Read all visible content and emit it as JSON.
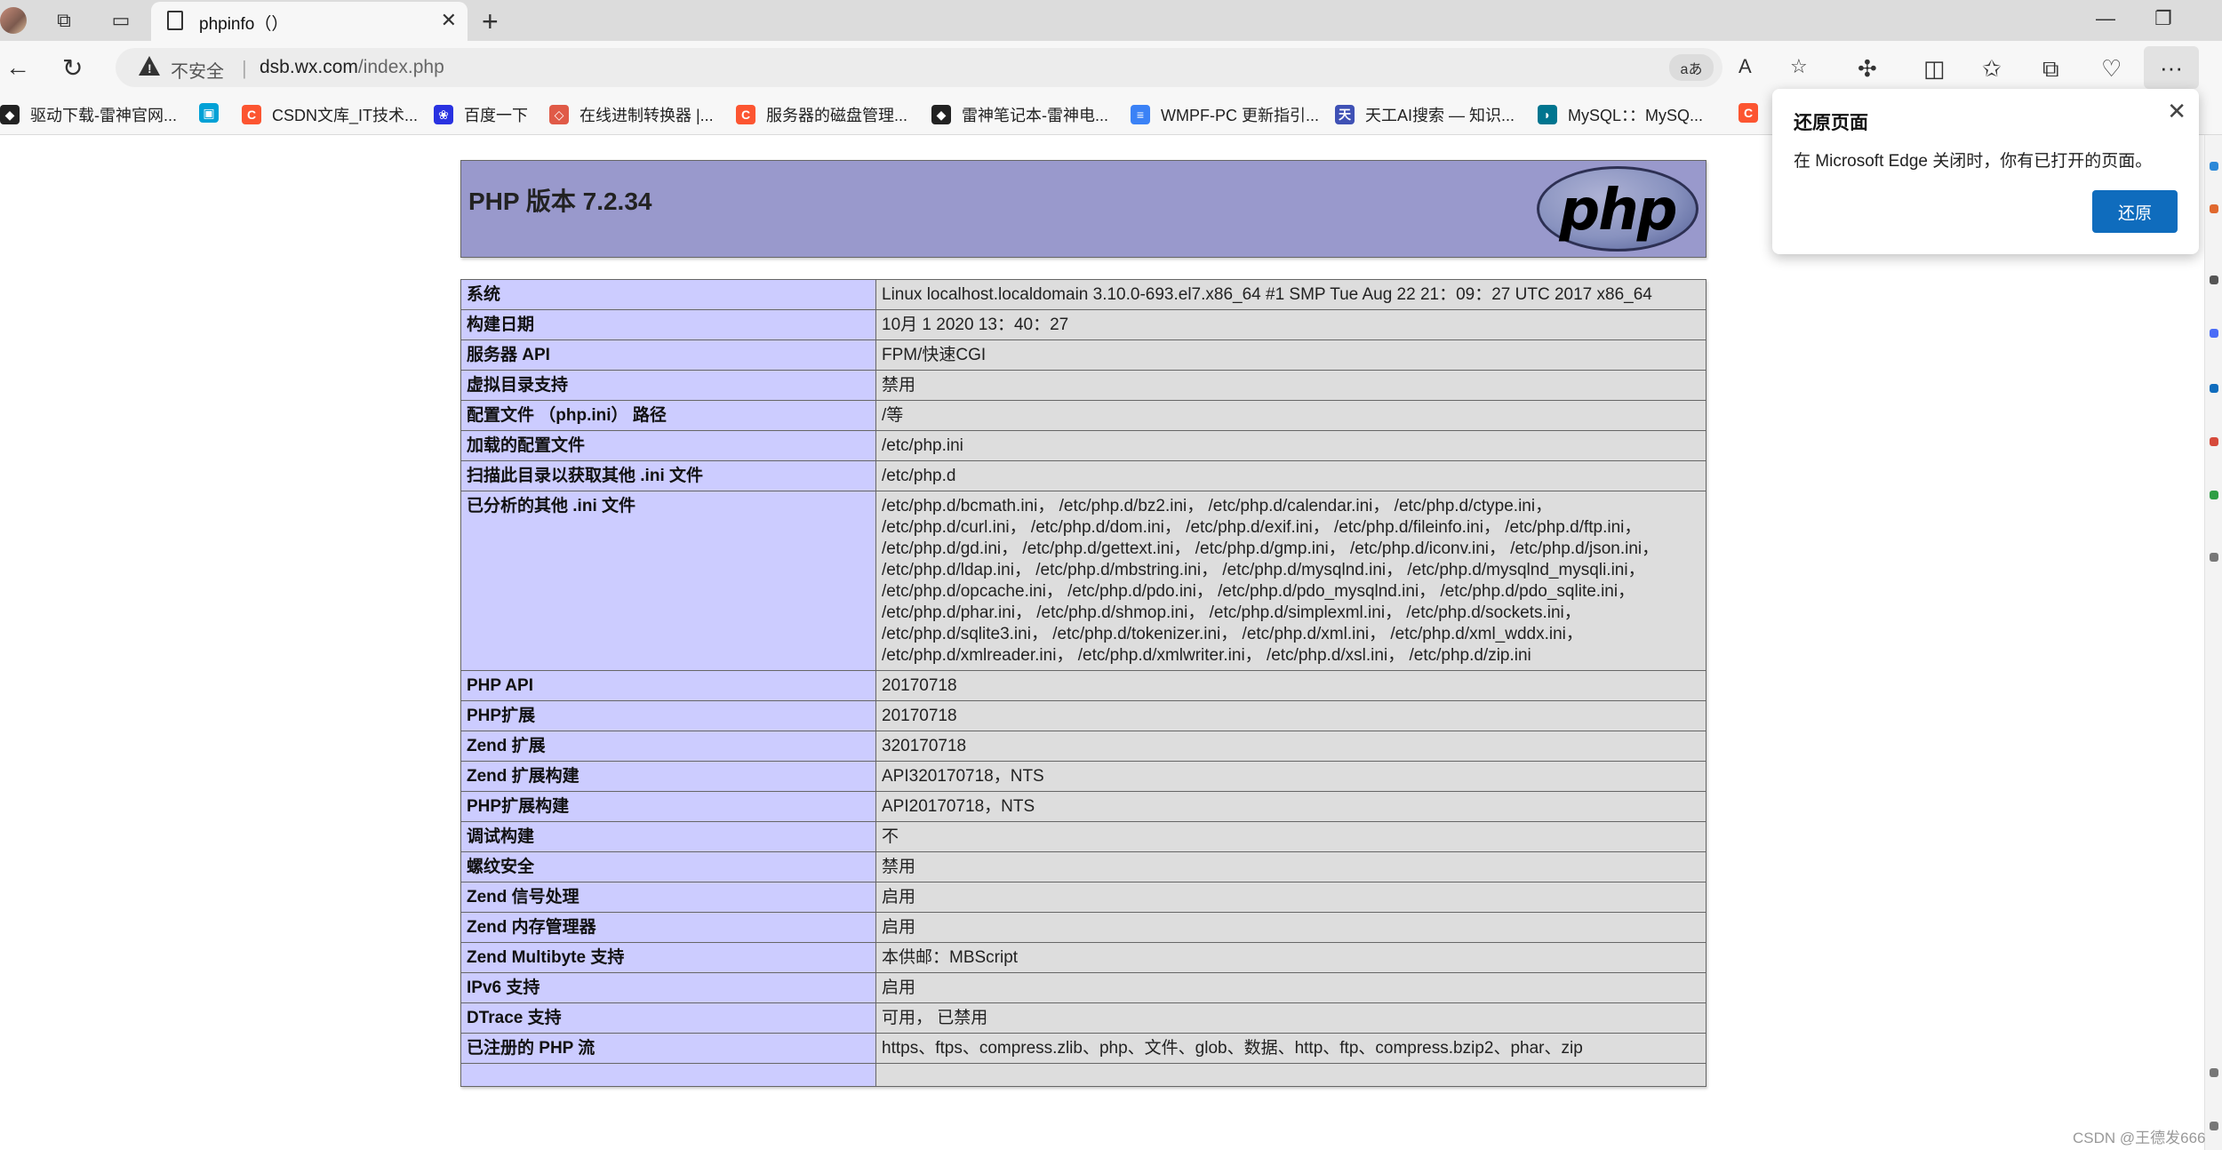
{
  "browser": {
    "tab_title": "phpinfo（）",
    "address_insecure": "不安全",
    "url_host": "dsb.wx.com",
    "url_path": "/index.php",
    "translate_label": "aあ",
    "more_label": "···"
  },
  "bookmarks": [
    {
      "label": "驱动下载-雷神官网...",
      "icon": "leishen-icon",
      "color": "#222222"
    },
    {
      "label": "",
      "icon": "bilibili-icon",
      "color": "#00a1d6"
    },
    {
      "label": "CSDN文库_IT技术...",
      "icon": "csdn-icon",
      "color": "#fc5531"
    },
    {
      "label": "百度一下",
      "icon": "baidu-icon",
      "color": "#2932e1"
    },
    {
      "label": "在线进制转换器 |...",
      "icon": "converter-icon",
      "color": "#e05a47"
    },
    {
      "label": "服务器的磁盘管理...",
      "icon": "csdn-icon",
      "color": "#fc5531"
    },
    {
      "label": "雷神笔记本-雷神电...",
      "icon": "leishen-icon",
      "color": "#222222"
    },
    {
      "label": "WMPF-PC 更新指引...",
      "icon": "doc-icon",
      "color": "#3b82f6"
    },
    {
      "label": "天工AI搜索 — 知识...",
      "icon": "tiangong-icon",
      "color": "#3f51b5"
    },
    {
      "label": "MySQL：：MySQ...",
      "icon": "mysql-icon",
      "color": "#00758f"
    },
    {
      "label": "",
      "icon": "csdn-icon",
      "color": "#fc5531"
    }
  ],
  "restore_popup": {
    "title": "还原页面",
    "message": "在 Microsoft Edge 关闭时，你有已打开的页面。",
    "button": "还原"
  },
  "php": {
    "header_title": "PHP 版本 7.2.34",
    "logo_text": "php",
    "rows": [
      {
        "k": "系统",
        "v": "Linux localhost.localdomain 3.10.0-693.el7.x86_64 #1 SMP Tue Aug 22 21：09：27 UTC 2017 x86_64"
      },
      {
        "k": "构建日期",
        "v": "10月 1 2020 13：40：27"
      },
      {
        "k": "服务器 API",
        "v": "FPM/快速CGI"
      },
      {
        "k": "虚拟目录支持",
        "v": "禁用"
      },
      {
        "k": "配置文件 （php.ini） 路径",
        "v": "/等"
      },
      {
        "k": "加载的配置文件",
        "v": "/etc/php.ini"
      },
      {
        "k": "扫描此目录以获取其他 .ini 文件",
        "v": "/etc/php.d"
      },
      {
        "k": "已分析的其他 .ini 文件",
        "v": "/etc/php.d/bcmath.ini， /etc/php.d/bz2.ini， /etc/php.d/calendar.ini， /etc/php.d/ctype.ini， /etc/php.d/curl.ini， /etc/php.d/dom.ini， /etc/php.d/exif.ini， /etc/php.d/fileinfo.ini， /etc/php.d/ftp.ini， /etc/php.d/gd.ini， /etc/php.d/gettext.ini， /etc/php.d/gmp.ini， /etc/php.d/iconv.ini， /etc/php.d/json.ini， /etc/php.d/ldap.ini， /etc/php.d/mbstring.ini， /etc/php.d/mysqlnd.ini， /etc/php.d/mysqlnd_mysqli.ini， /etc/php.d/opcache.ini， /etc/php.d/pdo.ini， /etc/php.d/pdo_mysqlnd.ini， /etc/php.d/pdo_sqlite.ini， /etc/php.d/phar.ini， /etc/php.d/shmop.ini， /etc/php.d/simplexml.ini， /etc/php.d/sockets.ini， /etc/php.d/sqlite3.ini， /etc/php.d/tokenizer.ini， /etc/php.d/xml.ini， /etc/php.d/xml_wddx.ini， /etc/php.d/xmlreader.ini， /etc/php.d/xmlwriter.ini， /etc/php.d/xsl.ini， /etc/php.d/zip.ini"
      },
      {
        "k": "PHP API",
        "v": "20170718"
      },
      {
        "k": "PHP扩展",
        "v": "20170718"
      },
      {
        "k": "Zend 扩展",
        "v": "320170718"
      },
      {
        "k": "Zend 扩展构建",
        "v": "API320170718，NTS"
      },
      {
        "k": "PHP扩展构建",
        "v": "API20170718，NTS"
      },
      {
        "k": "调试构建",
        "v": "不"
      },
      {
        "k": "螺纹安全",
        "v": "禁用"
      },
      {
        "k": "Zend 信号处理",
        "v": "启用"
      },
      {
        "k": "Zend 内存管理器",
        "v": "启用"
      },
      {
        "k": "Zend Multibyte 支持",
        "v": "本供邮：MBScript"
      },
      {
        "k": "IPv6 支持",
        "v": "启用"
      },
      {
        "k": "DTrace 支持",
        "v": "可用， 已禁用"
      },
      {
        "k": "已注册的 PHP 流",
        "v": "https、ftps、compress.zlib、php、文件、glob、数据、http、ftp、compress.bzip2、phar、zip"
      },
      {
        "k": "",
        "v": ""
      }
    ]
  },
  "watermark": "CSDN @王德发666"
}
